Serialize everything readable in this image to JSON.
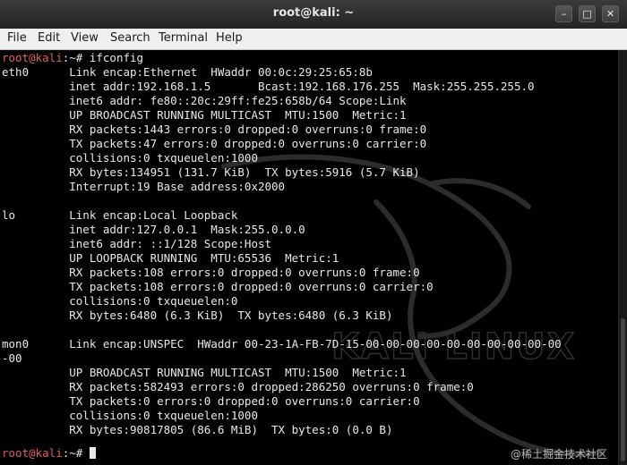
{
  "window": {
    "title": "root@kali: ~",
    "minimize_glyph": "–",
    "maximize_glyph": "□",
    "close_glyph": "✕"
  },
  "menu": {
    "file": "File",
    "edit": "Edit",
    "view": "View",
    "search": "Search",
    "terminal": "Terminal",
    "help": "Help"
  },
  "prompt": {
    "host": "root@kali",
    "path": ":~#"
  },
  "lines": {
    "cmd": " ifconfig",
    "l1": "eth0      Link encap:Ethernet  HWaddr 00:0c:29:25:65:8b",
    "l2": "          inet addr:192.168.1.5       Bcast:192.168.176.255  Mask:255.255.255.0",
    "l3": "          inet6 addr: fe80::20c:29ff:fe25:658b/64 Scope:Link",
    "l4": "          UP BROADCAST RUNNING MULTICAST  MTU:1500  Metric:1",
    "l5": "          RX packets:1443 errors:0 dropped:0 overruns:0 frame:0",
    "l6": "          TX packets:47 errors:0 dropped:0 overruns:0 carrier:0",
    "l7": "          collisions:0 txqueuelen:1000",
    "l8": "          RX bytes:134951 (131.7 KiB)  TX bytes:5916 (5.7 KiB)",
    "l9": "          Interrupt:19 Base address:0x2000",
    "l10": "lo        Link encap:Local Loopback",
    "l11": "          inet addr:127.0.0.1  Mask:255.0.0.0",
    "l12": "          inet6 addr: ::1/128 Scope:Host",
    "l13": "          UP LOOPBACK RUNNING  MTU:65536  Metric:1",
    "l14": "          RX packets:108 errors:0 dropped:0 overruns:0 frame:0",
    "l15": "          TX packets:108 errors:0 dropped:0 overruns:0 carrier:0",
    "l16": "          collisions:0 txqueuelen:0",
    "l17": "          RX bytes:6480 (6.3 KiB)  TX bytes:6480 (6.3 KiB)",
    "l18": "mon0      Link encap:UNSPEC  HWaddr 00-23-1A-FB-7D-15-00-00-00-00-00-00-00-00-00-00",
    "l19": "-00",
    "l20": "          UP BROADCAST RUNNING MULTICAST  MTU:1500  Metric:1",
    "l21": "          RX packets:582493 errors:0 dropped:286250 overruns:0 frame:0",
    "l22": "          TX packets:0 errors:0 dropped:0 overruns:0 carrier:0",
    "l23": "          collisions:0 txqueuelen:1000",
    "l24": "          RX bytes:90817805 (86.6 MiB)  TX bytes:0 (0.0 B)"
  },
  "background_logo": "KALI LINUX",
  "watermark": "@稀土掘金技术社区",
  "colors": {
    "terminal_bg": "#000000",
    "text": "#e8e8e8",
    "prompt_host": "#e06060"
  }
}
